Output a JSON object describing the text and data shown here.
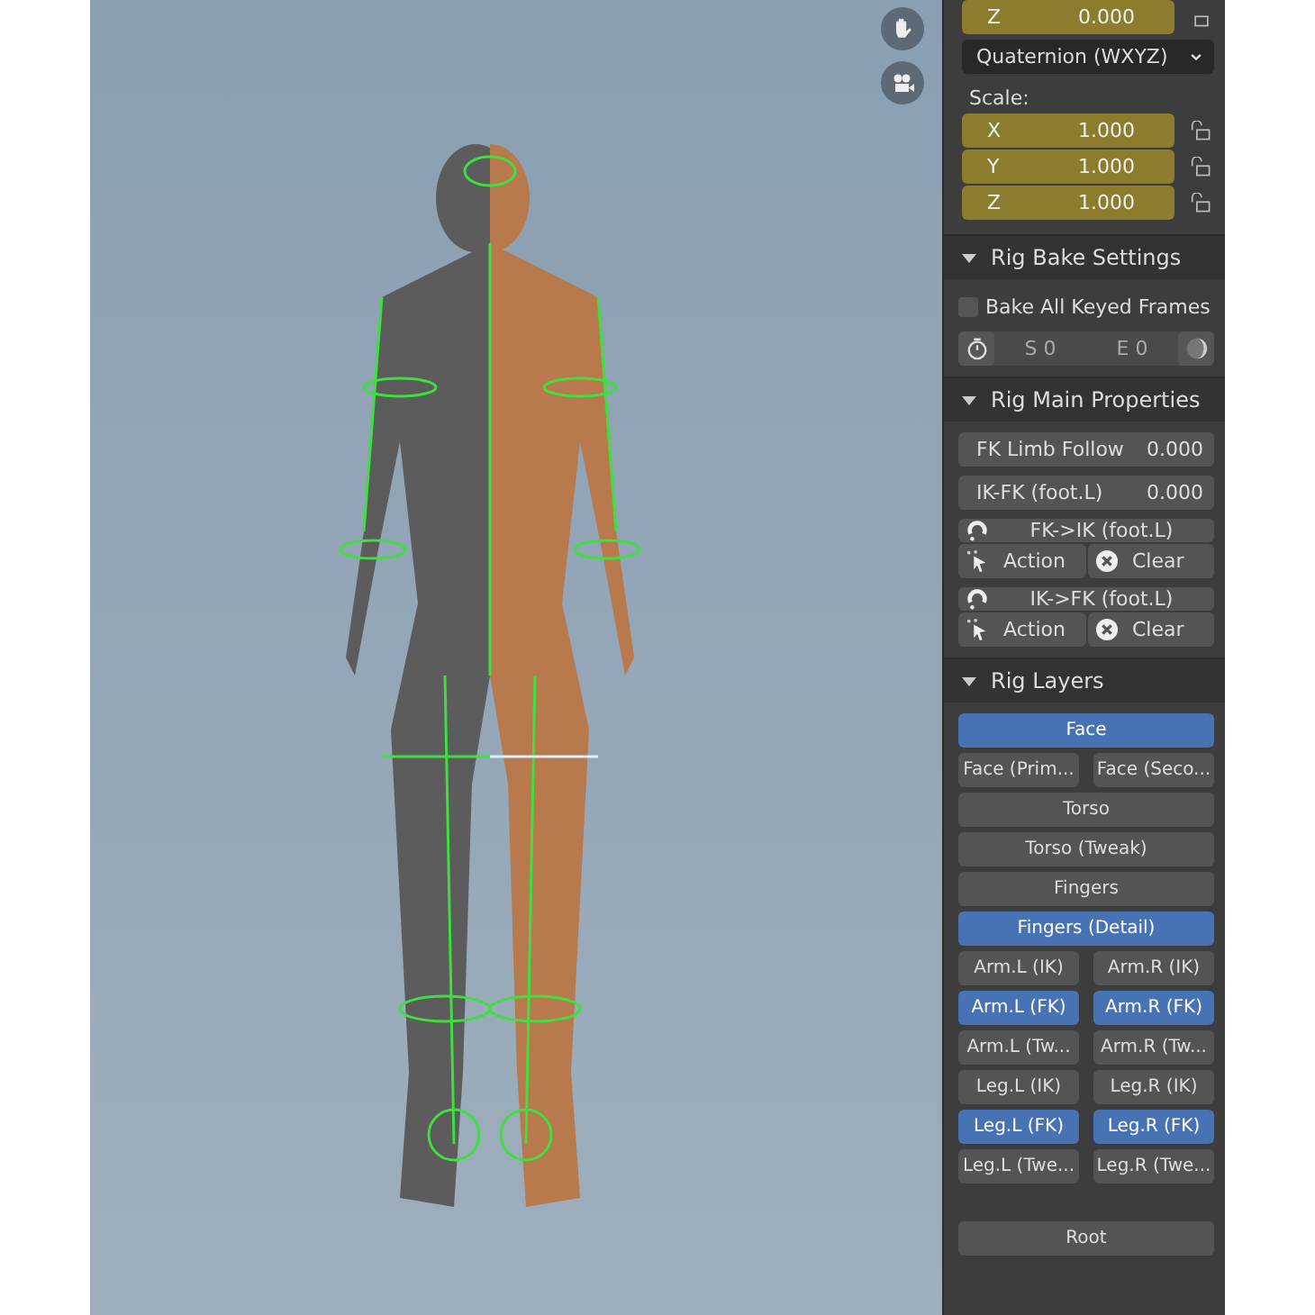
{
  "transform": {
    "top_row": {
      "axis": "Z",
      "value": "0.000"
    },
    "rotation_mode": "Quaternion (WXYZ)",
    "scale_label": "Scale:",
    "scale": [
      {
        "axis": "X",
        "value": "1.000",
        "locked": false
      },
      {
        "axis": "Y",
        "value": "1.000",
        "locked": false
      },
      {
        "axis": "Z",
        "value": "1.000",
        "locked": false
      }
    ]
  },
  "bake": {
    "title": "Rig Bake Settings",
    "expanded": true,
    "checkbox": {
      "label": "Bake All Keyed Frames",
      "checked": false
    },
    "start": "S 0",
    "end": "E 0"
  },
  "main": {
    "title": "Rig Main Properties",
    "expanded": true,
    "properties": [
      {
        "label": "FK Limb Follow",
        "value": "0.000"
      },
      {
        "label": "IK-FK (foot.L)",
        "value": "0.000"
      }
    ],
    "operators": [
      {
        "title": "FK->IK (foot.L)",
        "action": "Action",
        "clear": "Clear"
      },
      {
        "title": "IK->FK (foot.L)",
        "action": "Action",
        "clear": "Clear"
      }
    ]
  },
  "layers": {
    "title": "Rig Layers",
    "expanded": true,
    "rows": [
      [
        {
          "label": "Face",
          "selected": true
        }
      ],
      [
        {
          "label": "Face (Prim...",
          "selected": false
        },
        {
          "label": "Face (Seco...",
          "selected": false
        }
      ],
      [
        {
          "label": "Torso",
          "selected": false
        }
      ],
      [
        {
          "label": "Torso (Tweak)",
          "selected": false
        }
      ],
      [
        {
          "label": "Fingers",
          "selected": false
        }
      ],
      [
        {
          "label": "Fingers (Detail)",
          "selected": true
        }
      ],
      [
        {
          "label": "Arm.L (IK)",
          "selected": false
        },
        {
          "label": "Arm.R (IK)",
          "selected": false
        }
      ],
      [
        {
          "label": "Arm.L (FK)",
          "selected": true
        },
        {
          "label": "Arm.R (FK)",
          "selected": true
        }
      ],
      [
        {
          "label": "Arm.L (Tw...",
          "selected": false
        },
        {
          "label": "Arm.R (Tw...",
          "selected": false
        }
      ],
      [
        {
          "label": "Leg.L (IK)",
          "selected": false
        },
        {
          "label": "Leg.R (IK)",
          "selected": false
        }
      ],
      [
        {
          "label": "Leg.L (FK)",
          "selected": true
        },
        {
          "label": "Leg.R (FK)",
          "selected": true
        }
      ],
      [
        {
          "label": "Leg.L (Twe...",
          "selected": false
        },
        {
          "label": "Leg.R (Twe...",
          "selected": false
        }
      ]
    ],
    "root": {
      "label": "Root",
      "selected": false
    }
  }
}
